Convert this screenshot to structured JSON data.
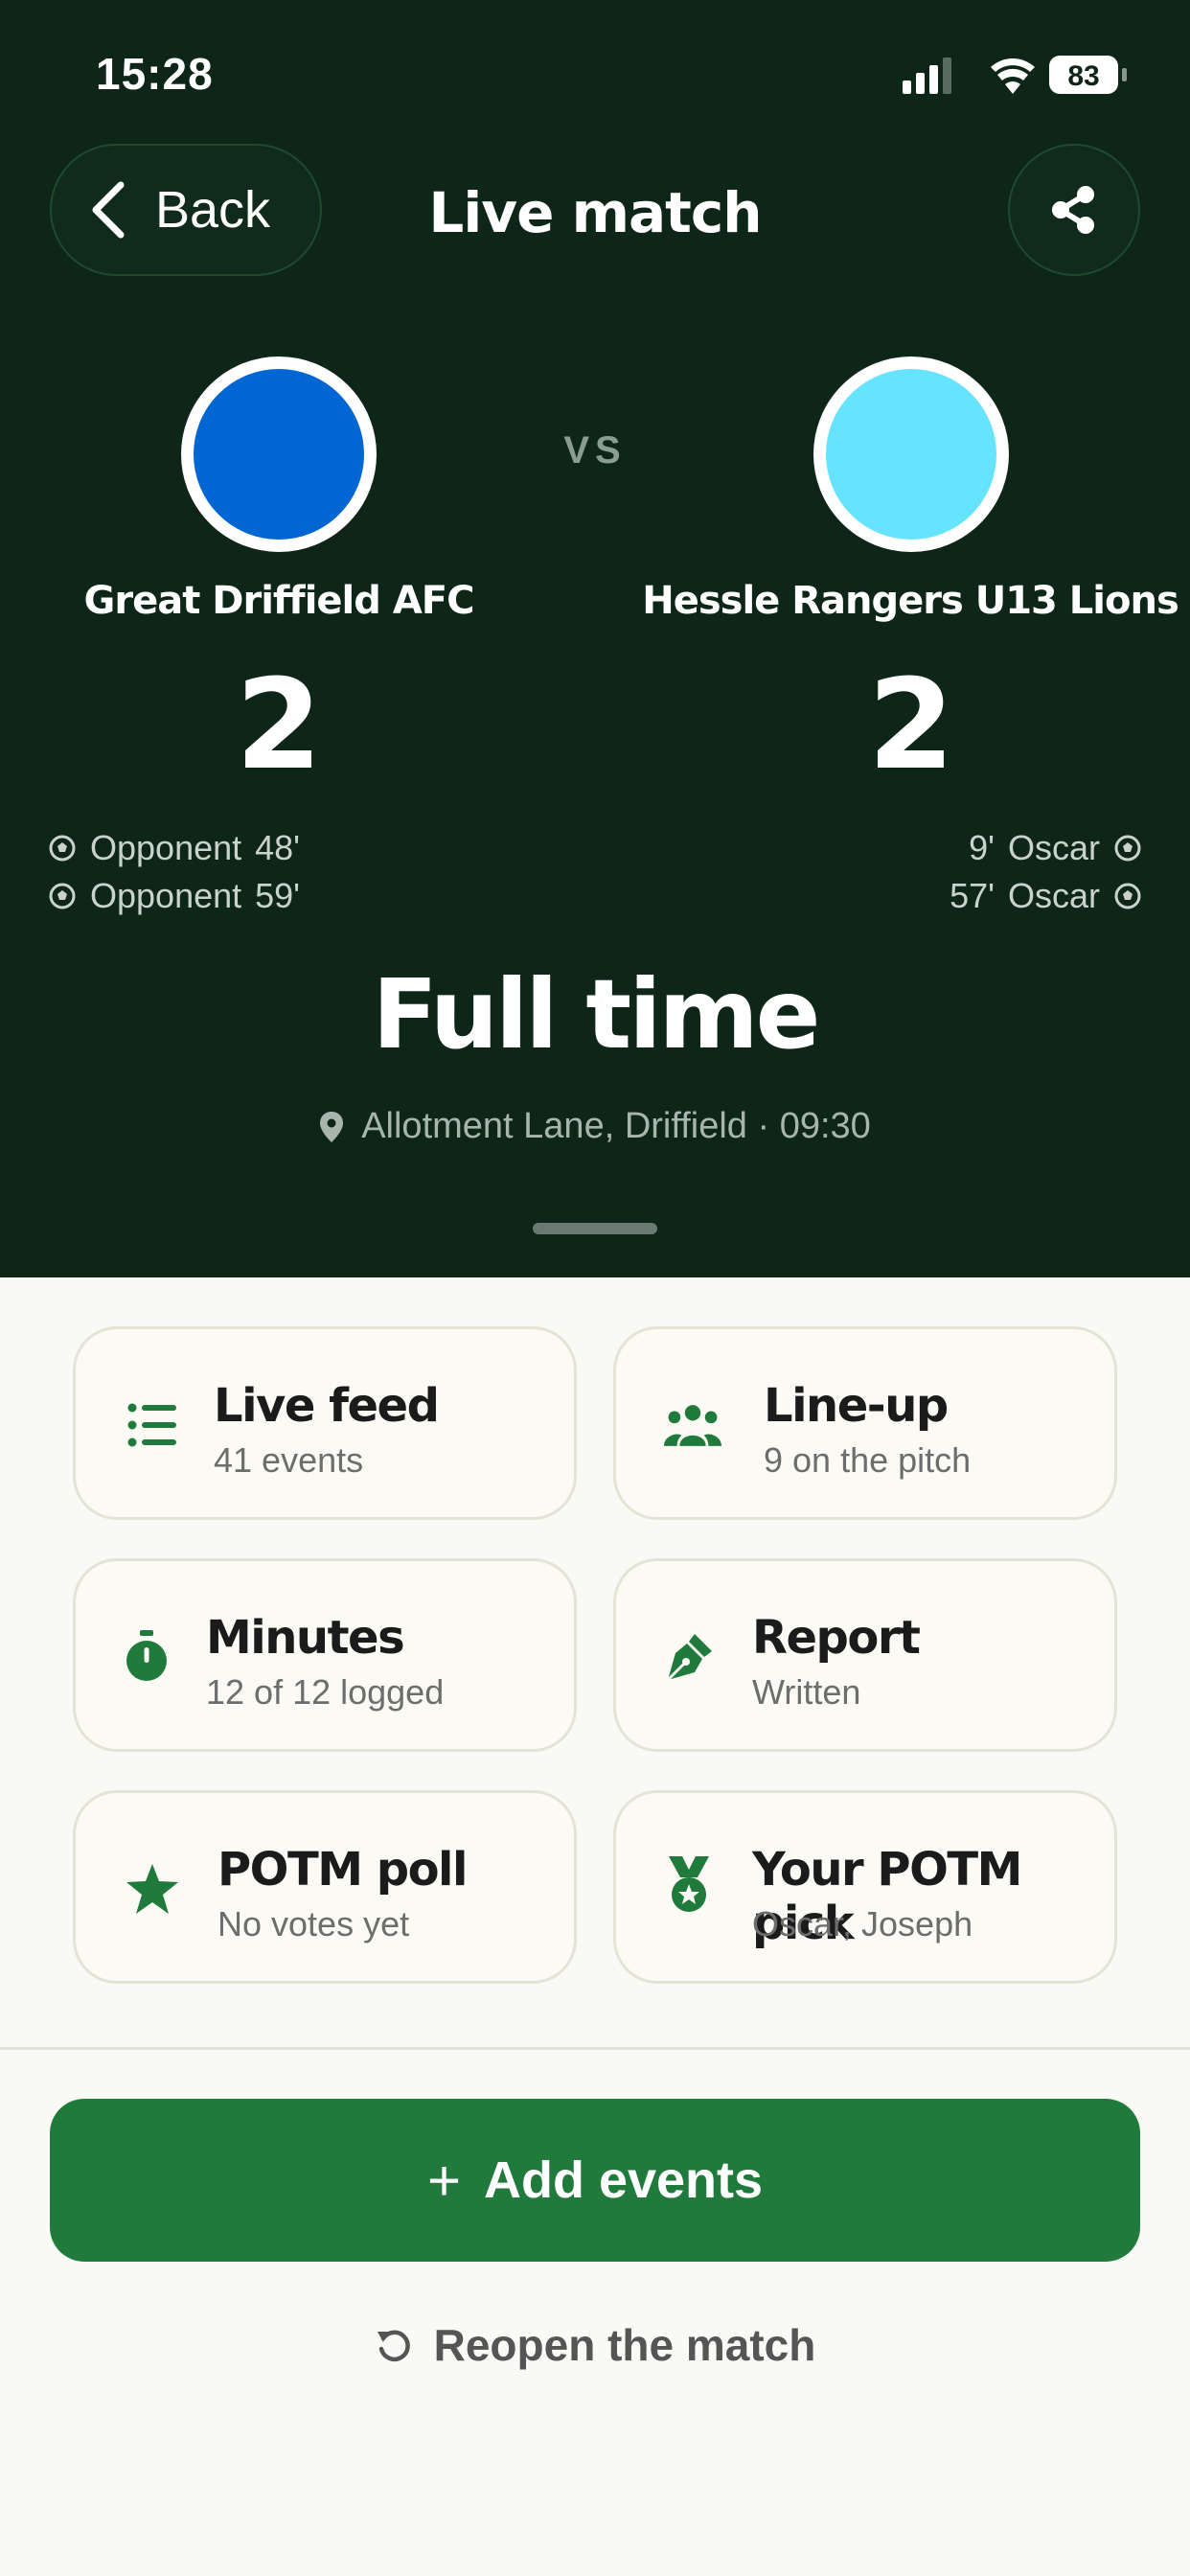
{
  "status_bar": {
    "time": "15:28",
    "battery": "83"
  },
  "header": {
    "back_label": "Back",
    "title": "Live match"
  },
  "match": {
    "vs_label": "VS",
    "home": {
      "name": "Great Driffield AFC",
      "score": "2",
      "crest_color": "#0066d4",
      "scorers": [
        {
          "name": "Opponent",
          "minute": "48'"
        },
        {
          "name": "Opponent",
          "minute": "59'"
        }
      ]
    },
    "away": {
      "name": "Hessle Rangers U13 Lions",
      "score": "2",
      "crest_color": "#66e3ff",
      "scorers": [
        {
          "name": "Oscar",
          "minute": "9'"
        },
        {
          "name": "Oscar",
          "minute": "57'"
        }
      ]
    },
    "status": "Full time",
    "venue": "Allotment Lane, Driffield · 09:30"
  },
  "cards": [
    {
      "title": "Live feed",
      "subtitle": "41 events",
      "icon": "list-icon"
    },
    {
      "title": "Line-up",
      "subtitle": "9 on the pitch",
      "icon": "people-icon"
    },
    {
      "title": "Minutes",
      "subtitle": "12 of 12 logged",
      "icon": "stopwatch-icon"
    },
    {
      "title": "Report",
      "subtitle": "Written",
      "icon": "pen-icon"
    },
    {
      "title": "POTM poll",
      "subtitle": "No votes yet",
      "icon": "star-icon"
    },
    {
      "title": "Your POTM pick",
      "subtitle": "Oscar, Joseph",
      "icon": "medal-icon"
    }
  ],
  "actions": {
    "add_events": "Add events",
    "reopen": "Reopen the match"
  },
  "colors": {
    "hero_bg": "#0d2617",
    "accent": "#207a3c",
    "page_bg": "#f9f9f6"
  }
}
